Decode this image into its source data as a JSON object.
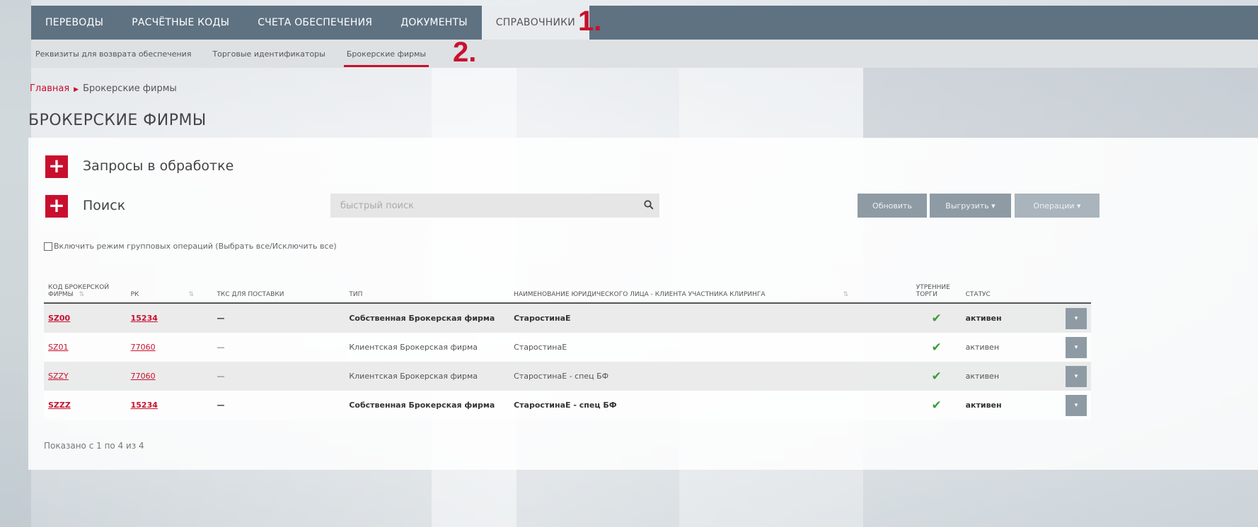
{
  "top_nav": {
    "items": [
      {
        "label": "ПЕРЕВОДЫ"
      },
      {
        "label": "РАСЧЁТНЫЕ КОДЫ"
      },
      {
        "label": "СЧЕТА ОБЕСПЕЧЕНИЯ"
      },
      {
        "label": "ДОКУМЕНТЫ"
      },
      {
        "label": "СПРАВОЧНИКИ",
        "active": true
      }
    ],
    "marker": "1."
  },
  "sub_nav": {
    "items": [
      {
        "label": "Реквизиты для возврата обеспечения"
      },
      {
        "label": "Торговые идентификаторы"
      },
      {
        "label": "Брокерские фирмы",
        "active": true
      }
    ],
    "marker": "2."
  },
  "breadcrumb": {
    "home": "Главная",
    "current": "Брокерские фирмы"
  },
  "page_title": "БРОКЕРСКИЕ ФИРМЫ",
  "sections": {
    "requests_label": "Запросы в обработке",
    "search_label": "Поиск",
    "plus_symbol": "+"
  },
  "search": {
    "placeholder": "быстрый поиск"
  },
  "actions": {
    "refresh": "Обновить",
    "export": "Выгрузить ▾",
    "operations": "Операции ▾"
  },
  "group_mode_label": "Включить режим групповых операций (Выбрать все/Исключить все)",
  "table": {
    "headers": {
      "code": "КОД БРОКЕРСКОЙ ФИРМЫ",
      "rk": "РК",
      "tks": "ТКС ДЛЯ ПОСТАВКИ",
      "type": "ТИП",
      "name": "НАИМЕНОВАНИЕ ЮРИДИЧЕСКОГО ЛИЦА - КЛИЕНТА УЧАСТНИКА КЛИРИНГА",
      "morning": "УТРЕННИЕ ТОРГИ",
      "status": "СТАТУС"
    },
    "rows": [
      {
        "code": "SZ00",
        "rk": "15234",
        "tks": "—",
        "type": "Собственная Брокерская фирма",
        "name": "СтаростинаЕ",
        "morning": "✔",
        "status": "активен"
      },
      {
        "code": "SZ01",
        "rk": "77060",
        "tks": "—",
        "type": "Клиентская Брокерская фирма",
        "name": "СтаростинаЕ",
        "morning": "✔",
        "status": "активен"
      },
      {
        "code": "SZZY",
        "rk": "77060",
        "tks": "—",
        "type": "Клиентская Брокерская фирма",
        "name": "СтаростинаЕ - спец БФ",
        "morning": "✔",
        "status": "активен"
      },
      {
        "code": "SZZZ",
        "rk": "15234",
        "tks": "—",
        "type": "Собственная Брокерская фирма",
        "name": "СтаростинаЕ - спец БФ",
        "morning": "✔",
        "status": "активен"
      }
    ],
    "row_button_symbol": "▾"
  },
  "footer_info": "Показано с 1 по 4 из 4",
  "colors": {
    "accent": "#c8102e",
    "nav": "#5f7282",
    "button": "#8e9ba5",
    "check": "#3a9e36"
  }
}
